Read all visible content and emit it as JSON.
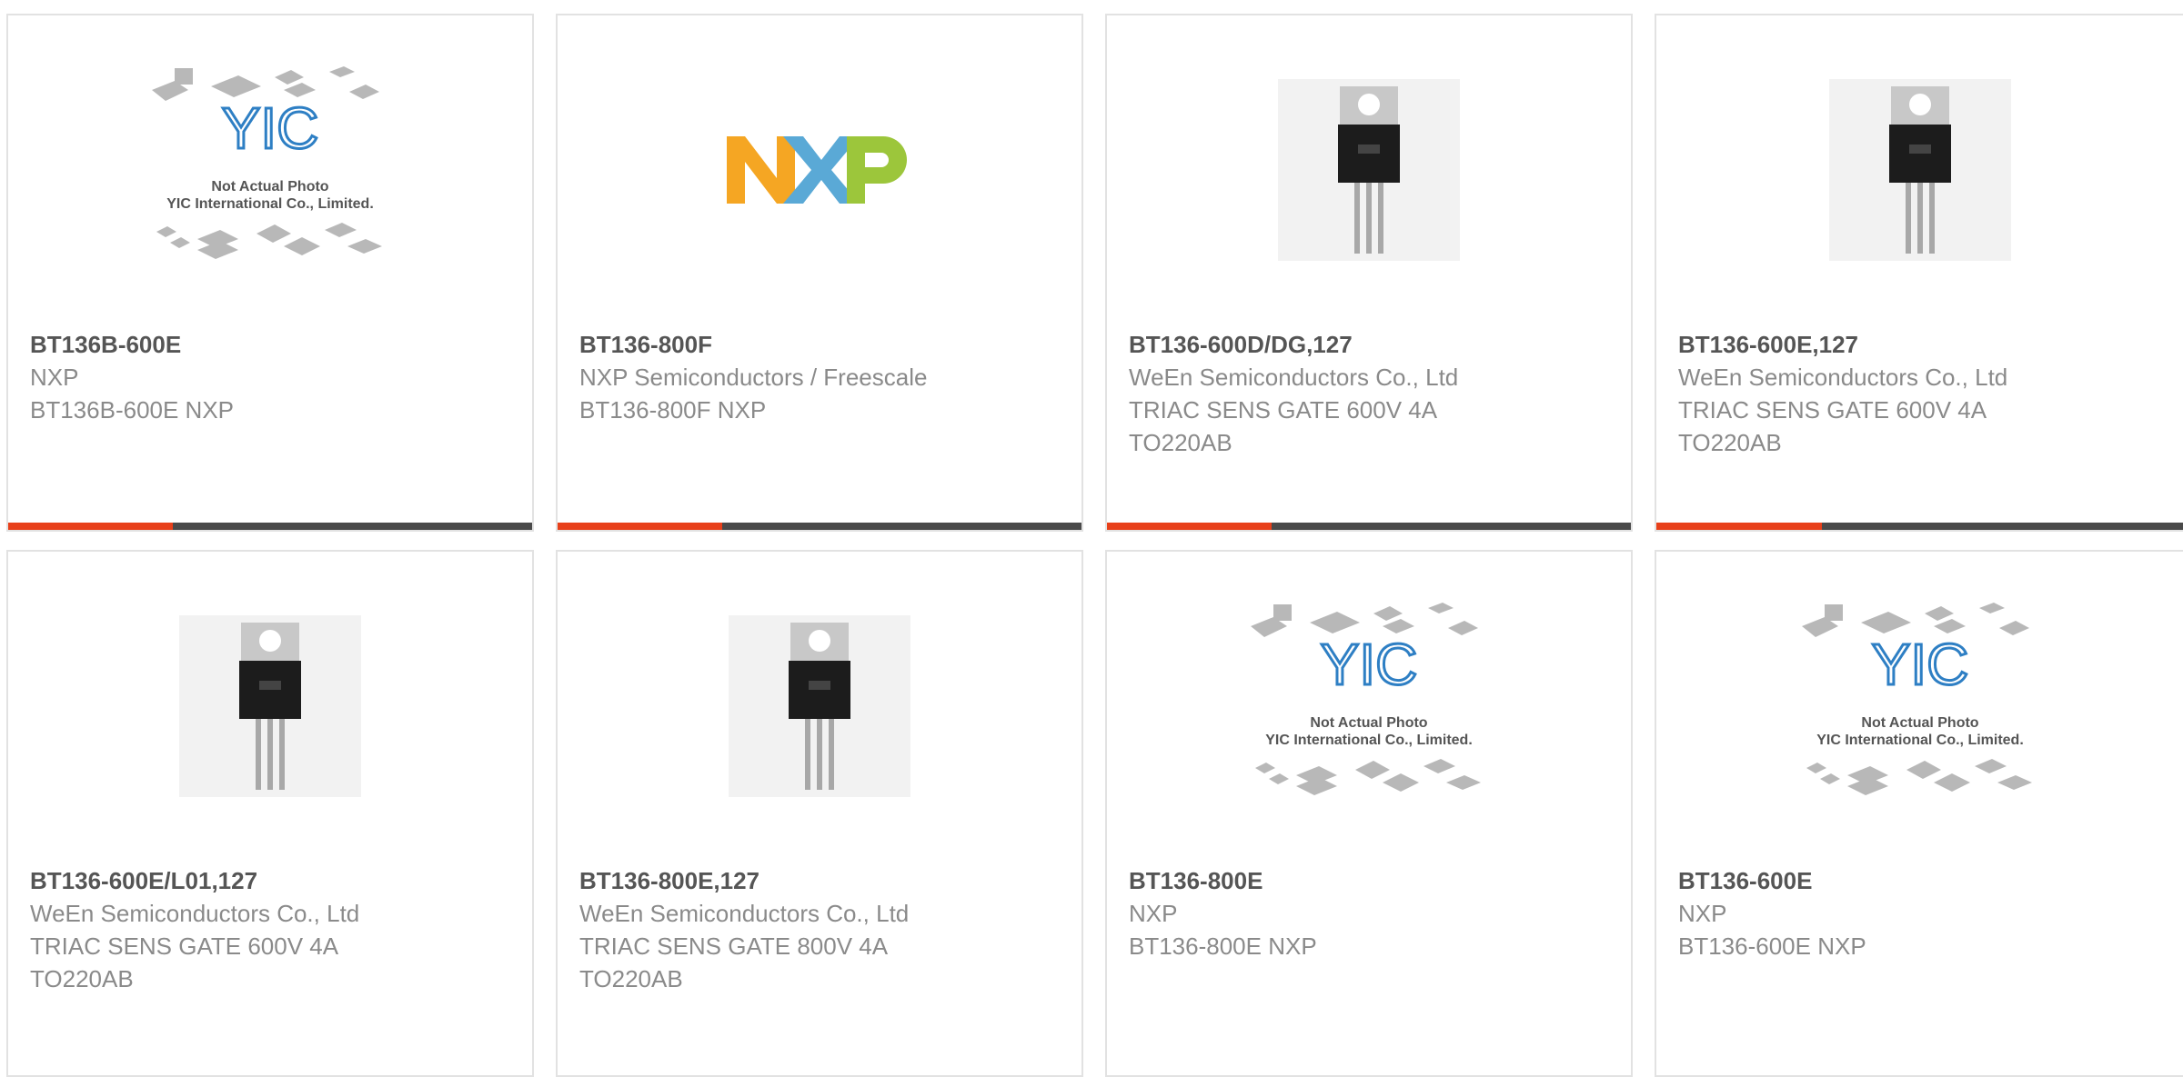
{
  "colors": {
    "accent": "#e8401a",
    "bar": "#4a4a4a",
    "title": "#555555",
    "text": "#8a8a8a"
  },
  "placeholder": {
    "line1": "Not Actual Photo",
    "line2": "YIC International Co., Limited.",
    "logo": "YIC"
  },
  "products": [
    {
      "part_number": "BT136B-600E",
      "manufacturer": "NXP",
      "description": "BT136B-600E NXP",
      "image": "yic-placeholder-icon"
    },
    {
      "part_number": "BT136-800F",
      "manufacturer": "NXP Semiconductors / Freescale",
      "description": "BT136-800F NXP",
      "image": "nxp-logo-icon"
    },
    {
      "part_number": "BT136-600D/DG,127",
      "manufacturer": "WeEn Semiconductors Co., Ltd",
      "description": "TRIAC SENS GATE 600V 4A TO220AB",
      "image": "to220-transistor-icon"
    },
    {
      "part_number": "BT136-600E,127",
      "manufacturer": "WeEn Semiconductors Co., Ltd",
      "description": "TRIAC SENS GATE 600V 4A TO220AB",
      "image": "to220-transistor-icon"
    },
    {
      "part_number": "BT136-600E/L01,127",
      "manufacturer": "WeEn Semiconductors Co., Ltd",
      "description": "TRIAC SENS GATE 600V 4A TO220AB",
      "image": "to220-transistor-icon"
    },
    {
      "part_number": "BT136-800E,127",
      "manufacturer": "WeEn Semiconductors Co., Ltd",
      "description": "TRIAC SENS GATE 800V 4A TO220AB",
      "image": "to220-transistor-icon"
    },
    {
      "part_number": "BT136-800E",
      "manufacturer": "NXP",
      "description": "BT136-800E NXP",
      "image": "yic-placeholder-icon"
    },
    {
      "part_number": "BT136-600E",
      "manufacturer": "NXP",
      "description": "BT136-600E NXP",
      "image": "yic-placeholder-icon"
    }
  ]
}
